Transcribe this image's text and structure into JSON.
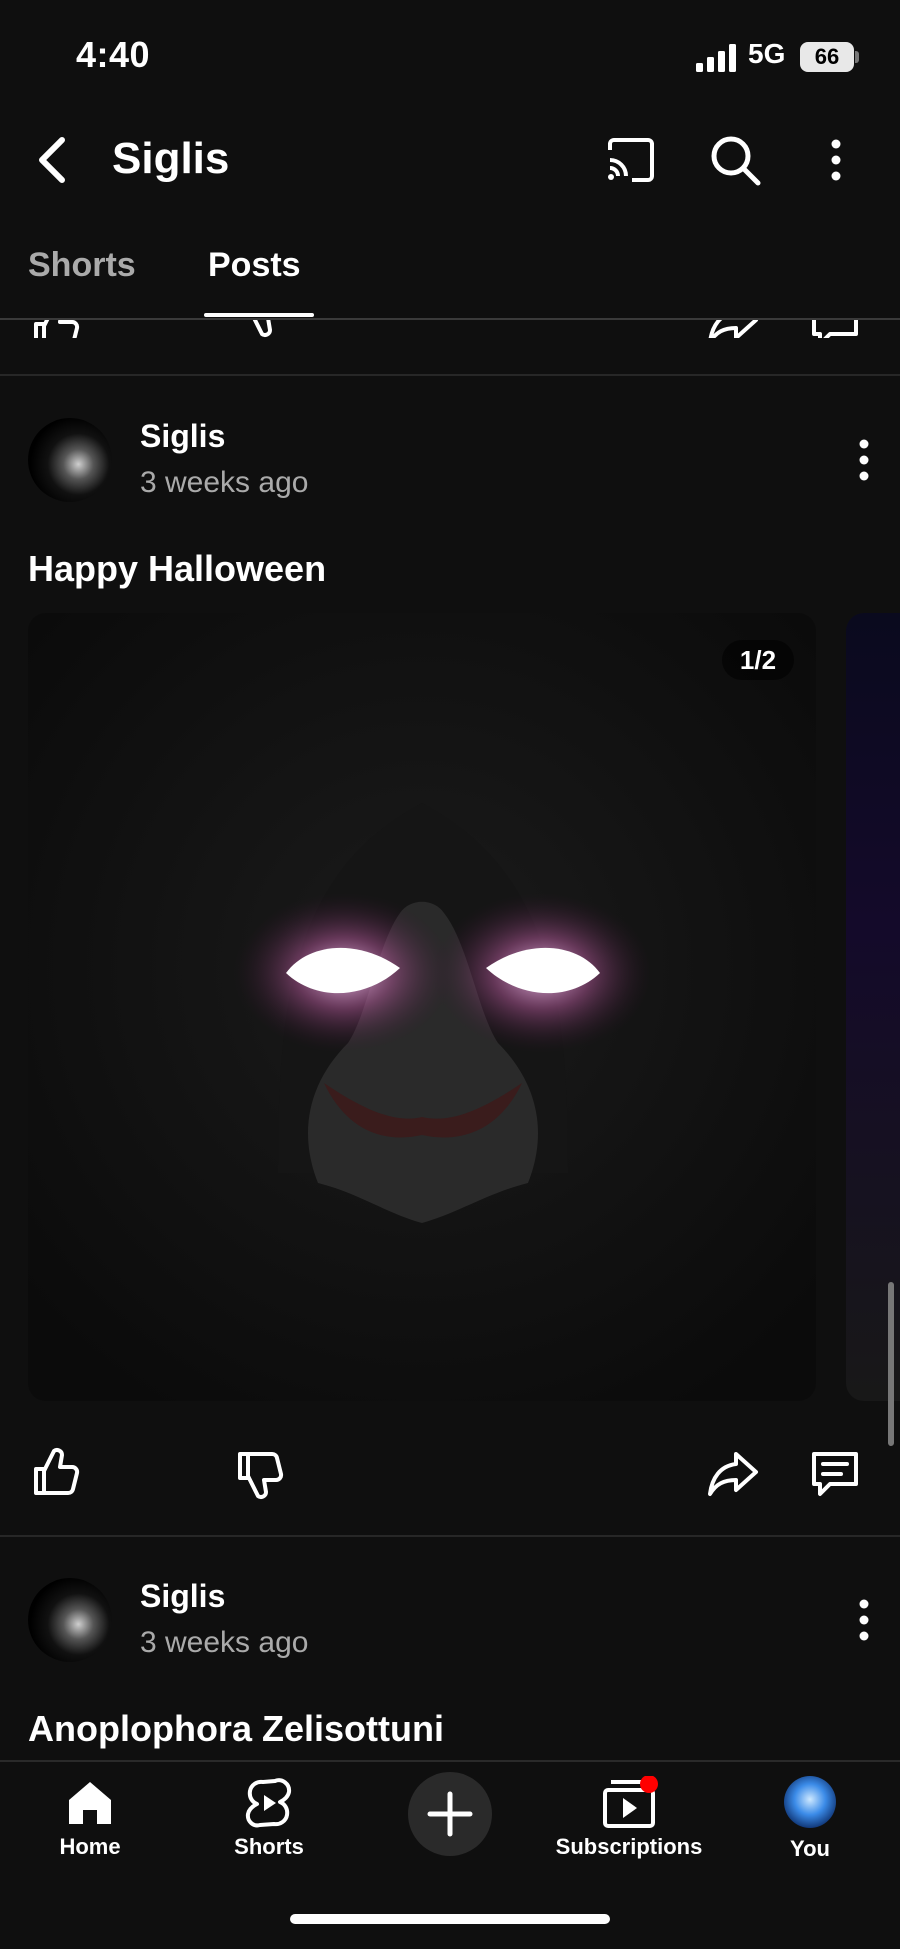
{
  "status_bar": {
    "time": "4:40",
    "network": "5G",
    "battery": "66"
  },
  "header": {
    "title": "Siglis"
  },
  "tabs": [
    {
      "label": "Shorts",
      "active": false
    },
    {
      "label": "Posts",
      "active": true
    }
  ],
  "posts": [
    {
      "author": "Siglis",
      "time": "3 weeks ago",
      "title": "Happy Halloween",
      "image_counter": "1/2"
    },
    {
      "author": "Siglis",
      "time": "3 weeks ago",
      "title": "Anoplophora Zelisottuni"
    }
  ],
  "bottom_nav": [
    {
      "label": "Home",
      "icon": "home-icon"
    },
    {
      "label": "Shorts",
      "icon": "shorts-icon"
    },
    {
      "label": "",
      "icon": "create-icon"
    },
    {
      "label": "Subscriptions",
      "icon": "subscriptions-icon"
    },
    {
      "label": "You",
      "icon": "avatar"
    }
  ],
  "colors": {
    "background": "#0f0f0f",
    "accent_red": "#ff0000",
    "secondary_text": "#aaaaaa"
  }
}
